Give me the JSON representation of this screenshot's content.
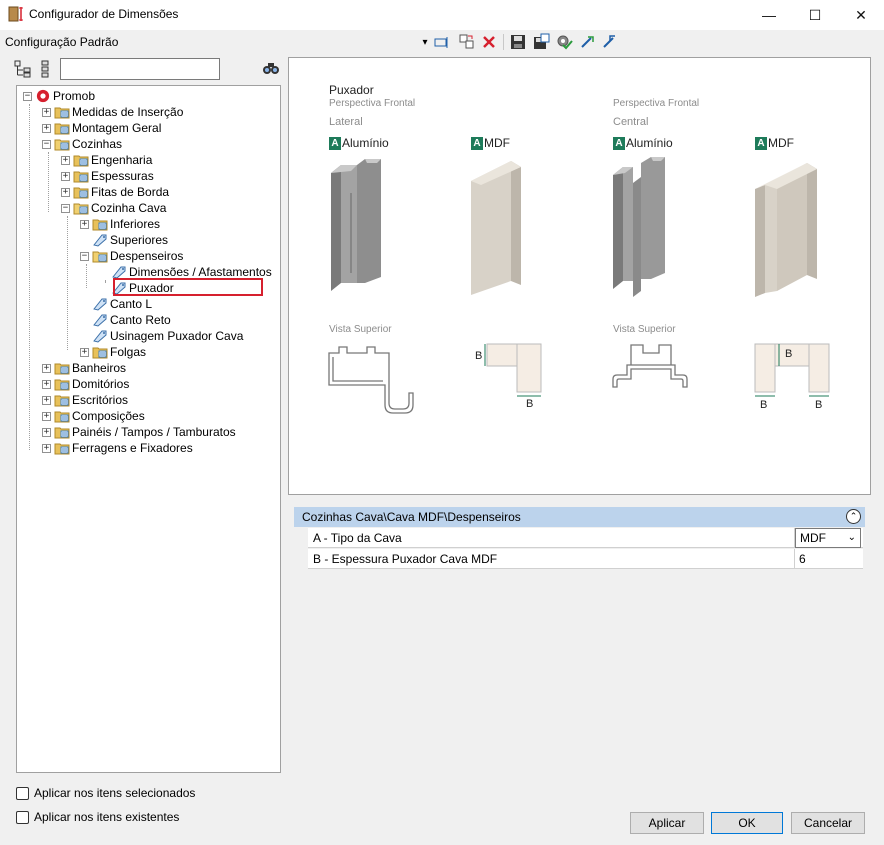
{
  "window": {
    "title": "Configurador de Dimensões",
    "minimize_glyph": "—",
    "maximize_glyph": "☐",
    "close_glyph": "✕"
  },
  "toolbar": {
    "config_label": "Configuração Padrão",
    "dropdown_glyph": "▾"
  },
  "search": {
    "value": ""
  },
  "tree": {
    "root": "Promob",
    "items": [
      {
        "label": "Medidas de Inserção"
      },
      {
        "label": "Montagem Geral"
      },
      {
        "label": "Cozinhas"
      },
      {
        "label": "Engenharia"
      },
      {
        "label": "Espessuras"
      },
      {
        "label": "Fitas de Borda"
      },
      {
        "label": "Cozinha Cava"
      },
      {
        "label": "Inferiores"
      },
      {
        "label": "Superiores"
      },
      {
        "label": "Despenseiros"
      },
      {
        "label": "Dimensões / Afastamentos"
      },
      {
        "label": "Puxador"
      },
      {
        "label": "Canto L"
      },
      {
        "label": "Canto Reto"
      },
      {
        "label": "Usinagem Puxador Cava"
      },
      {
        "label": "Folgas"
      },
      {
        "label": "Banheiros"
      },
      {
        "label": "Domitórios"
      },
      {
        "label": "Escritórios"
      },
      {
        "label": "Composições"
      },
      {
        "label": "Painéis / Tampos / Tamburatos"
      },
      {
        "label": "Ferragens e Fixadores"
      }
    ],
    "plus": "+",
    "minus": "−"
  },
  "checkboxes": {
    "selected_items": "Aplicar nos itens selecionados",
    "existing_items": "Aplicar nos itens existentes"
  },
  "image": {
    "title": "Puxador",
    "left_view": "Perspectiva Frontal",
    "left_type": "Lateral",
    "right_view": "Perspectiva Frontal",
    "right_type": "Central",
    "badge_letter": "A",
    "aluminio": "Alumínio",
    "mdf": "MDF",
    "top_view": "Vista Superior",
    "dim_b": "B"
  },
  "properties": {
    "path": "Cozinhas Cava\\Cava MDF\\Despenseiros",
    "collapse_glyph": "⌃",
    "rows": [
      {
        "name": "A - Tipo da Cava",
        "value": "MDF"
      },
      {
        "name": "B - Espessura Puxador Cava MDF",
        "value": "6"
      }
    ]
  },
  "buttons": {
    "apply": "Aplicar",
    "ok": "OK",
    "cancel": "Cancelar"
  },
  "colors": {
    "accent_green": "#1e7b5a",
    "selection_red": "#d6202e",
    "prop_header": "#bcd3ec"
  }
}
